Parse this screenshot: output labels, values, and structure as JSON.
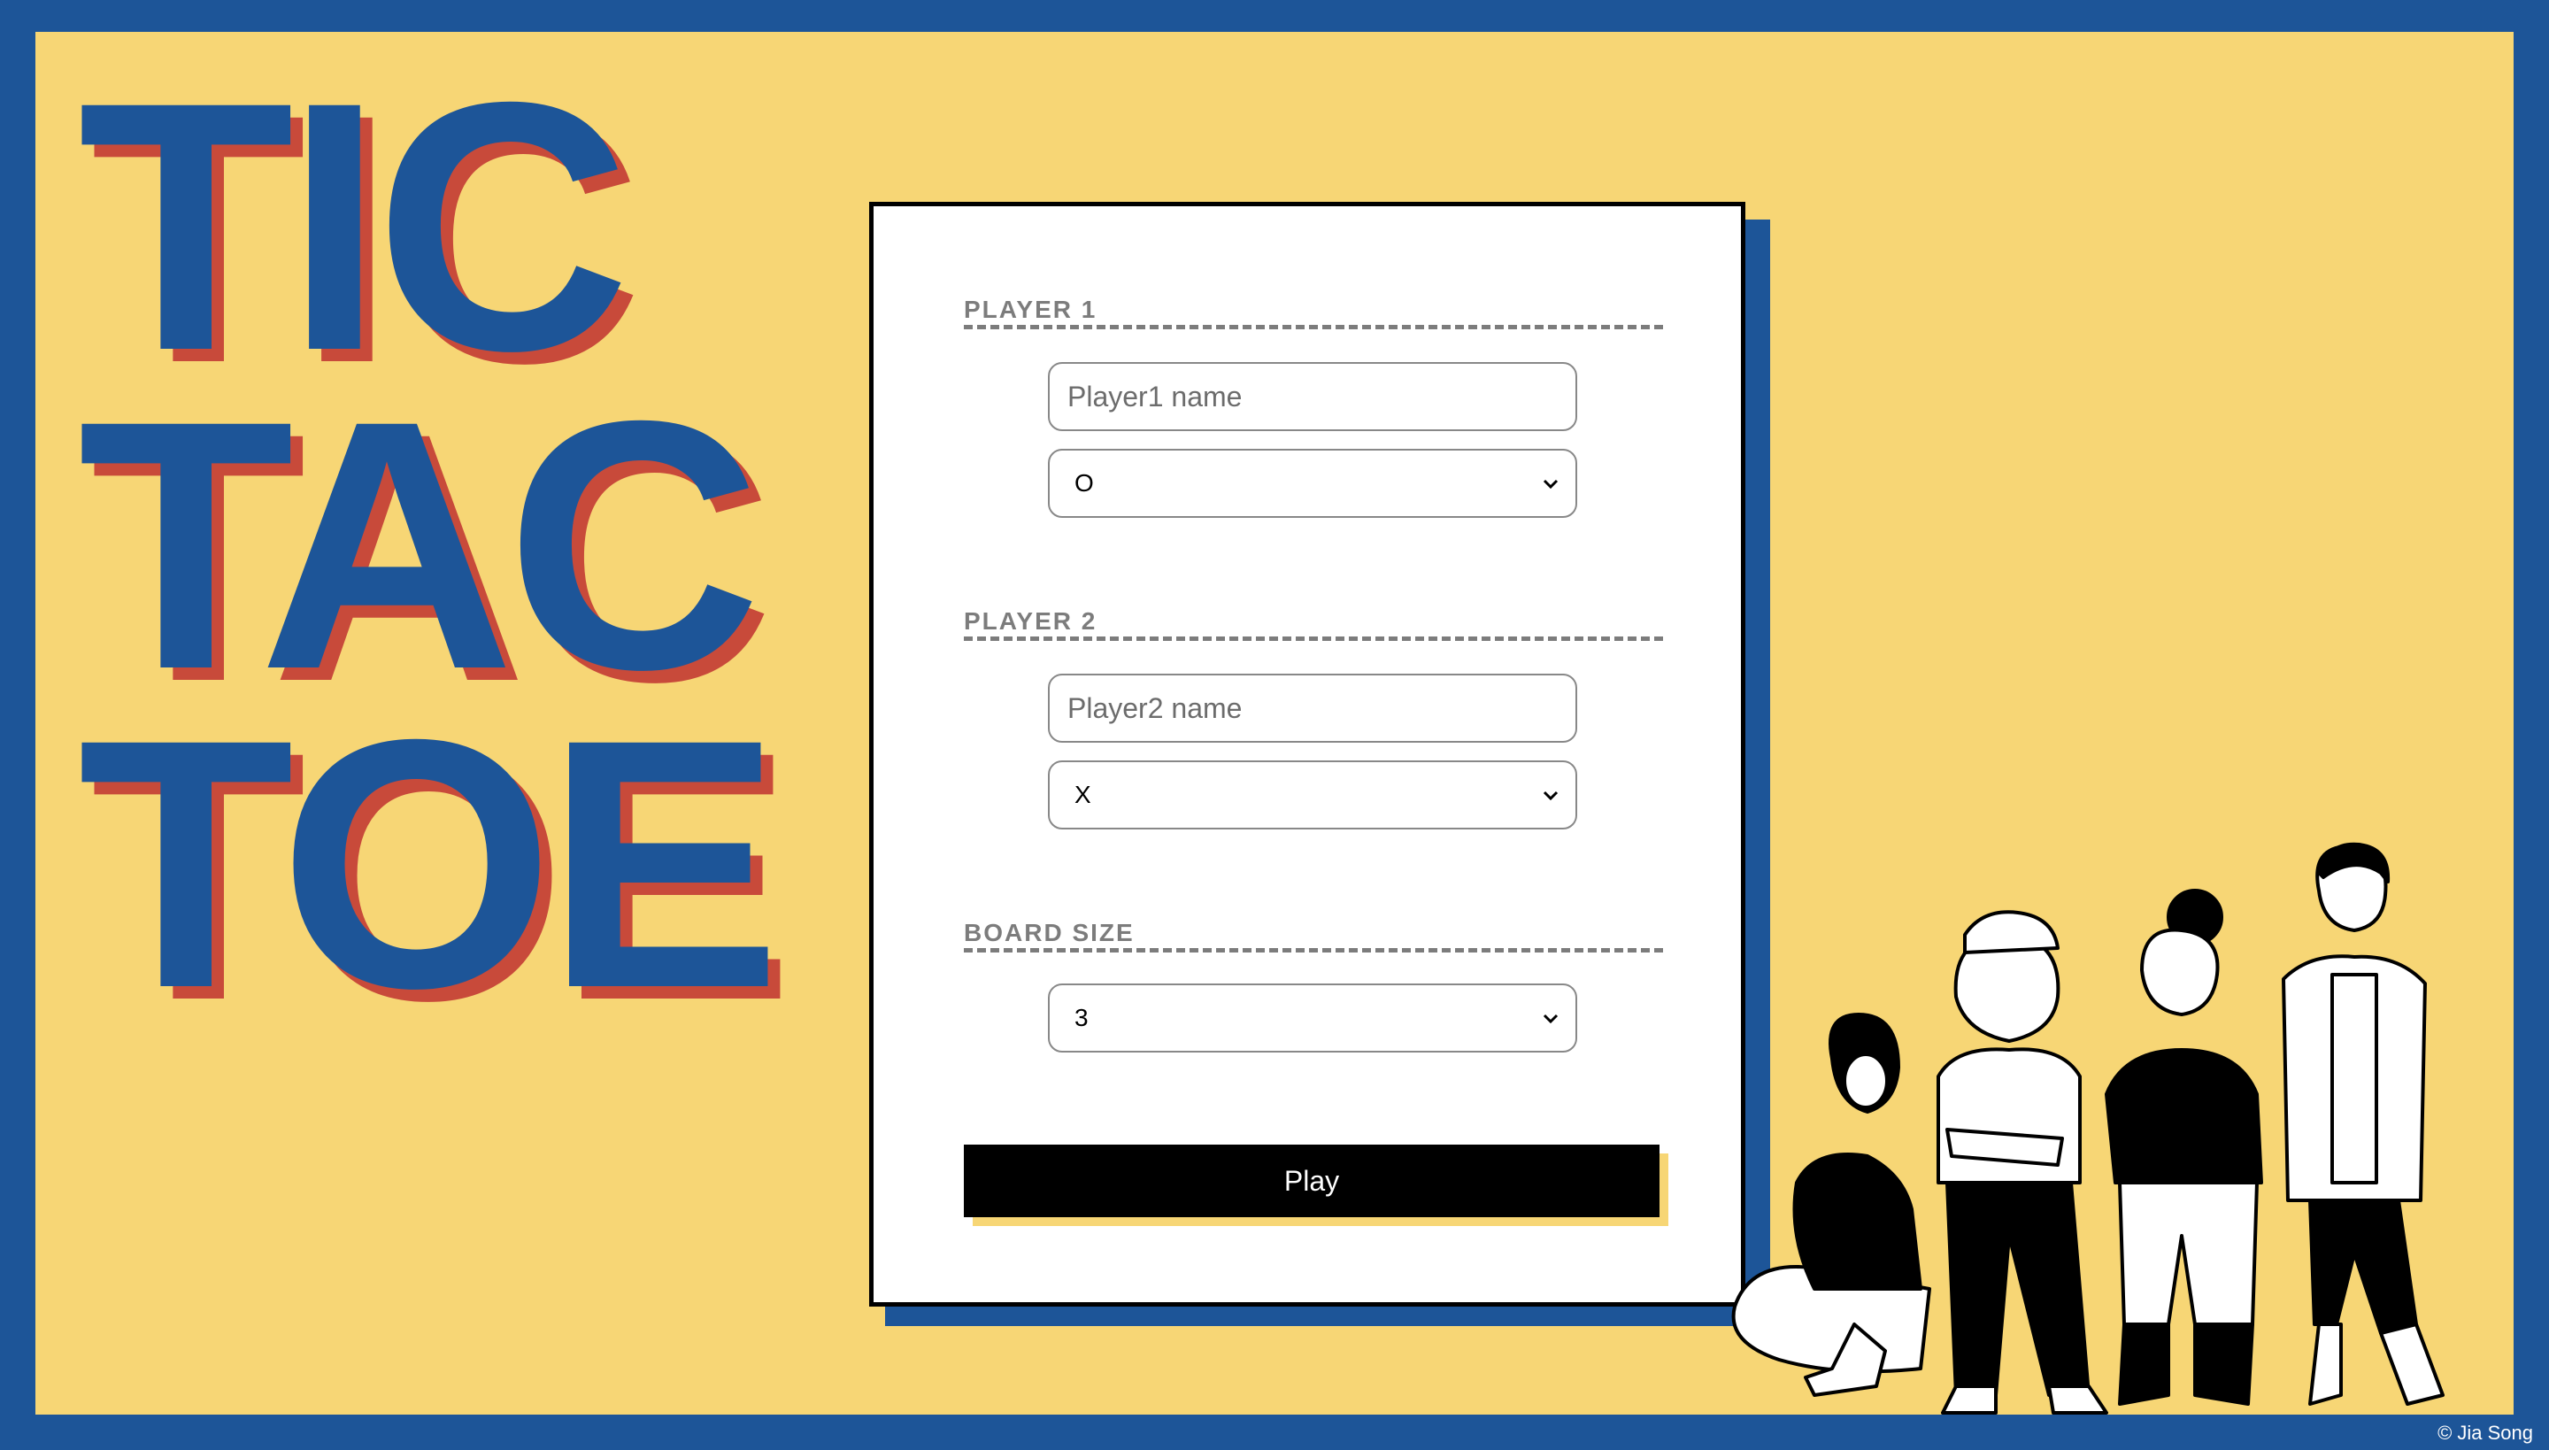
{
  "title": {
    "line1": "TIC",
    "line2": "TAC",
    "line3": "TOE"
  },
  "form": {
    "player1": {
      "label": "PLAYER 1",
      "name_placeholder": "Player1 name",
      "symbol_value": "O"
    },
    "player2": {
      "label": "PLAYER 2",
      "name_placeholder": "Player2 name",
      "symbol_value": "X"
    },
    "board": {
      "label": "BOARD SIZE",
      "size_value": "3"
    },
    "play_label": "Play"
  },
  "credit": "© Jia Song",
  "colors": {
    "background_blue": "#1d5598",
    "panel_yellow": "#f7d675",
    "title_shadow_red": "#c84a3a",
    "button_black": "#000000"
  }
}
